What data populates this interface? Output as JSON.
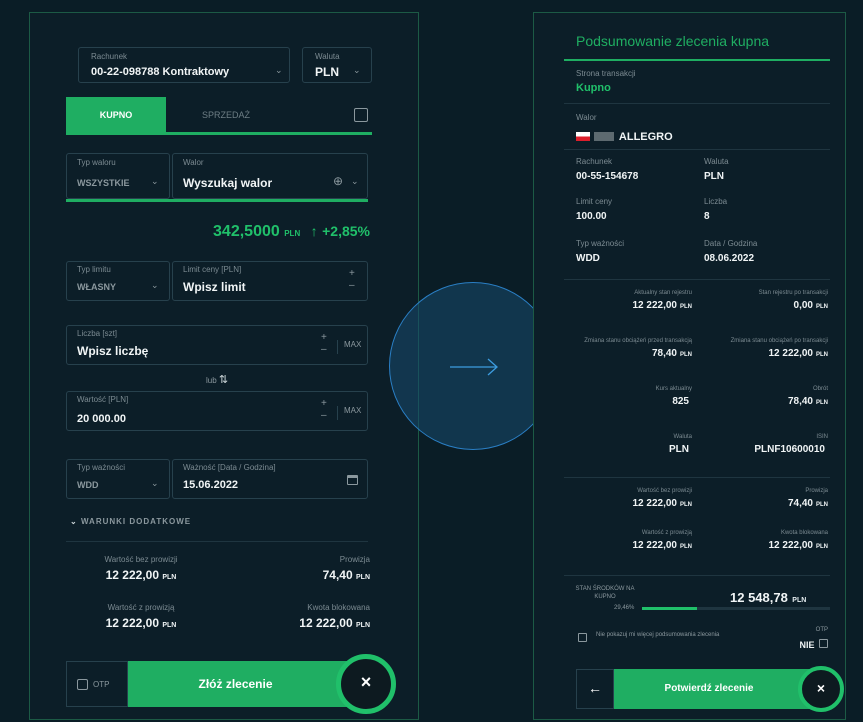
{
  "left": {
    "account": {
      "label": "Rachunek",
      "value": "00-22-098788 Kontraktowy"
    },
    "currency": {
      "label": "Waluta",
      "value": "PLN"
    },
    "tabs": {
      "buy": "KUPNO",
      "sell": "SPRZEDAŻ"
    },
    "instrument_type": {
      "label": "Typ waloru",
      "value": "WSZYSTKIE"
    },
    "instrument": {
      "label": "Walor",
      "placeholder": "Wyszukaj walor"
    },
    "price": {
      "value": "342,5000",
      "unit": "PLN",
      "change": "+2,85%"
    },
    "limit_type": {
      "label": "Typ limitu",
      "value": "WŁASNY"
    },
    "limit_price": {
      "label": "Limit ceny [PLN]",
      "placeholder": "Wpisz limit"
    },
    "quantity": {
      "label": "Liczba [szt]",
      "placeholder": "Wpisz liczbę",
      "max": "MAX"
    },
    "or_label": "lub",
    "value_field": {
      "label": "Wartość [PLN]",
      "value": "20 000.00",
      "max": "MAX"
    },
    "validity_type": {
      "label": "Typ ważności",
      "value": "WDD"
    },
    "validity_date": {
      "label": "Ważność [Data / Godzina]",
      "value": "15.06.2022"
    },
    "extra_conditions": "WARUNKI DODATKOWE",
    "summary": {
      "net_label": "Wartość bez prowizji",
      "net_value": "12 222,00",
      "net_unit": "PLN",
      "fee_label": "Prowizja",
      "fee_value": "74,40",
      "fee_unit": "PLN",
      "gross_label": "Wartość z prowizją",
      "gross_value": "12 222,00",
      "gross_unit": "PLN",
      "blocked_label": "Kwota blokowana",
      "blocked_value": "12 222,00",
      "blocked_unit": "PLN"
    },
    "otp_label": "OTP",
    "submit_label": "Złóż zlecenie",
    "close_symbol": "×"
  },
  "right": {
    "title": "Podsumowanie zlecenia kupna",
    "side": {
      "label": "Strona transakcji",
      "value": "Kupno"
    },
    "instrument": {
      "label": "Walor",
      "value": "ALLEGRO"
    },
    "account": {
      "label": "Rachunek",
      "value": "00-55-154678"
    },
    "currency": {
      "label": "Waluta",
      "value": "PLN"
    },
    "limit": {
      "label": "Limit ceny",
      "value": "100.00"
    },
    "qty": {
      "label": "Liczba",
      "value": "8"
    },
    "validity": {
      "label": "Typ ważności",
      "value": "WDD"
    },
    "date": {
      "label": "Data / Godzina",
      "value": "08.06.2022"
    },
    "grid1": [
      {
        "label": "Aktualny stan rejestru",
        "value": "12 222,00",
        "unit": "PLN"
      },
      {
        "label": "Stan rejestru po transakcji",
        "value": "0,00",
        "unit": "PLN"
      },
      {
        "label": "Zmiana stanu obciążeń przed transakcją",
        "value": "78,40",
        "unit": "PLN"
      },
      {
        "label": "Zmiana stanu obciążeń po transakcji",
        "value": "12 222,00",
        "unit": "PLN"
      },
      {
        "label": "Kurs aktualny",
        "value": "825",
        "unit": ""
      },
      {
        "label": "Obrót",
        "value": "78,40",
        "unit": "PLN"
      },
      {
        "label": "Waluta",
        "value": "PLN",
        "unit": ""
      },
      {
        "label": "ISIN",
        "value": "PLNF10600010",
        "unit": ""
      }
    ],
    "grid2": [
      {
        "label": "Wartość bez prowizji",
        "value": "12 222,00",
        "unit": "PLN"
      },
      {
        "label": "Prowizja",
        "value": "74,40",
        "unit": "PLN"
      },
      {
        "label": "Wartość z prowizją",
        "value": "12 222,00",
        "unit": "PLN"
      },
      {
        "label": "Kwota blokowana",
        "value": "12 222,00",
        "unit": "PLN"
      }
    ],
    "funds": {
      "label": "STAN ŚRODKÓW NA KUPNO",
      "value": "12 548,78",
      "unit": "PLN",
      "percent_label": "29,46%",
      "percent": 0.2946
    },
    "dont_show": "Nie pokazuj mi więcej podsumowania zlecenia",
    "otp": {
      "label": "OTP",
      "value": "NIE"
    },
    "confirm_label": "Potwierdź zlecenie",
    "back_symbol": "←",
    "close_symbol": "×"
  },
  "colors": {
    "accent": "#20c06a",
    "bg": "#0a1d26",
    "panel": "#0c1e28",
    "circle": "#2a7fc5"
  },
  "icons": [
    "chevron-down-icon",
    "calendar-icon",
    "globe-icon",
    "arrow-up-icon",
    "sort-icon",
    "close-icon",
    "back-arrow-icon",
    "right-arrow-icon",
    "flag-icon"
  ]
}
